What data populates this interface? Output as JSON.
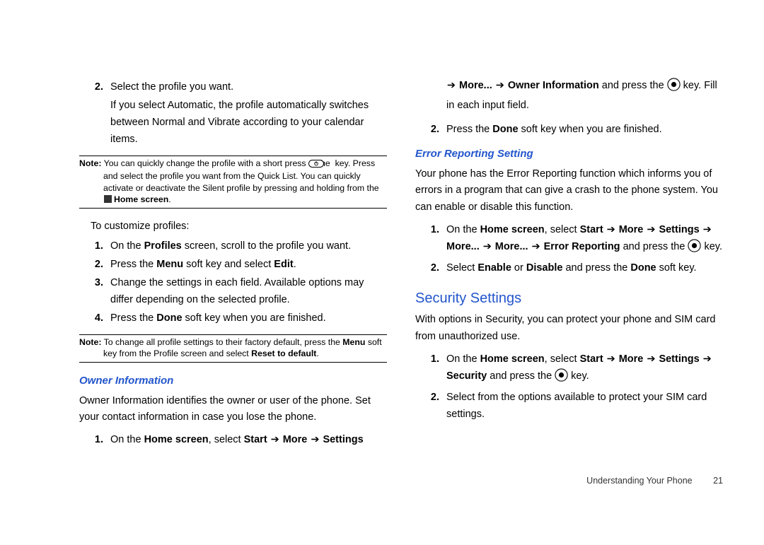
{
  "left": {
    "step2_num": "2.",
    "step2_text": "Select the profile you want.",
    "step2_cont": "If you select Automatic, the profile automatically switches between Normal and Vibrate according to your calendar items.",
    "note1_label": "Note:",
    "note1_a": "You can quickly change the profile with a short press of the ",
    "note1_b": " key. Press and select the profile you want from the Quick List. You can quickly activate or deactivate the Silent profile by pressing and holding from the ",
    "note1_home_bold": "Home screen",
    "note1_end": ".",
    "customize_lead": "To customize profiles:",
    "c1_num": "1.",
    "c1_a": "On the ",
    "c1_b_bold": "Profiles",
    "c1_c": " screen, scroll to the profile you want.",
    "c2_num": "2.",
    "c2_a": "Press the ",
    "c2_b_bold": "Menu",
    "c2_c": " soft key and select ",
    "c2_d_bold": "Edit",
    "c2_e": ".",
    "c3_num": "3.",
    "c3_text": "Change the settings in each field. Available options may differ depending on the selected profile.",
    "c4_num": "4.",
    "c4_a": "Press the ",
    "c4_b_bold": "Done",
    "c4_c": " soft key when you are finished.",
    "note2_label": "Note:",
    "note2_a": "To change all profile settings to their factory default, press the ",
    "note2_b_bold": "Menu",
    "note2_c": " soft key from the Profile screen and select ",
    "note2_d_bold": "Reset to default",
    "note2_e": ".",
    "owner_h": "Owner Information",
    "owner_para": "Owner Information identifies the owner or user of the phone. Set your contact information in case you lose the phone.",
    "o1_num": "1.",
    "o1_a": "On the ",
    "o1_b_bold": "Home screen",
    "o1_c": ", select ",
    "o1_nav1": "Start",
    "o1_nav2": "More",
    "o1_nav3": "Settings"
  },
  "right": {
    "cont_nav1": "More...",
    "cont_nav2": "Owner Information",
    "cont_a": " and press the ",
    "cont_b": " key. Fill in each input field.",
    "r2_num": "2.",
    "r2_a": "Press the ",
    "r2_b_bold": "Done",
    "r2_c": " soft key when you are finished.",
    "err_h": "Error Reporting Setting",
    "err_para": "Your phone has the Error Reporting function which informs you of errors in a program that can give a crash to the phone system. You can enable or disable this function.",
    "e1_num": "1.",
    "e1_a": "On the ",
    "e1_b_bold": "Home screen",
    "e1_c": ", select ",
    "e1_nav1": "Start",
    "e1_nav2": "More",
    "e1_nav3": "Settings",
    "e1_nav4": "More...",
    "e1_nav5": "More...",
    "e1_nav6": "Error Reporting",
    "e1_d": " and press the ",
    "e1_e": " key.",
    "e2_num": "2.",
    "e2_a": "Select ",
    "e2_b_bold": "Enable",
    "e2_c": " or ",
    "e2_d_bold": "Disable",
    "e2_e": " and press the ",
    "e2_f_bold": "Done",
    "e2_g": " soft key.",
    "sec_h": "Security Settings",
    "sec_para": "With options in Security, you can protect your phone and SIM card from unauthorized use.",
    "s1_num": "1.",
    "s1_a": "On the ",
    "s1_b_bold": "Home screen",
    "s1_c": ", select ",
    "s1_nav1": "Start",
    "s1_nav2": "More",
    "s1_nav3": "Settings",
    "s1_nav4": "Security",
    "s1_d": " and press the ",
    "s1_e": " key.",
    "s2_num": "2.",
    "s2_text": "Select from the options available to protect your SIM card settings."
  },
  "footer": {
    "section": "Understanding Your Phone",
    "page": "21"
  }
}
